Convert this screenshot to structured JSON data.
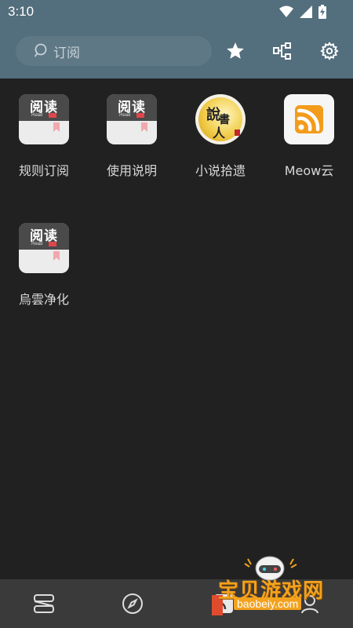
{
  "status_bar": {
    "time": "3:10"
  },
  "search": {
    "placeholder": "订阅"
  },
  "header_icons": [
    "star-icon",
    "share-nodes-icon",
    "gear-icon"
  ],
  "tiles": [
    {
      "label": "规则订阅",
      "icon": "book-read-icon",
      "big": "阅读",
      "small": "Read"
    },
    {
      "label": "使用说明",
      "icon": "book-read-icon",
      "big": "阅读",
      "small": "Read"
    },
    {
      "label": "小说拾遗",
      "icon": "storyteller-seal-icon",
      "seal": [
        "說",
        "書",
        "人"
      ]
    },
    {
      "label": "Meow云",
      "icon": "rss-icon"
    },
    {
      "label": "烏雲净化",
      "icon": "book-read-icon",
      "big": "阅读",
      "small": "Read"
    }
  ],
  "bottom_nav": [
    "bookshelf-icon",
    "compass-icon",
    "rss-nav-icon",
    "profile-icon"
  ],
  "watermark": {
    "title": "宝贝游戏网",
    "url": "baobeiy.com"
  },
  "colors": {
    "header": "#536e7d",
    "background": "#212121",
    "bottom_nav": "#3a3a3a",
    "rss": "#f39b1b"
  }
}
